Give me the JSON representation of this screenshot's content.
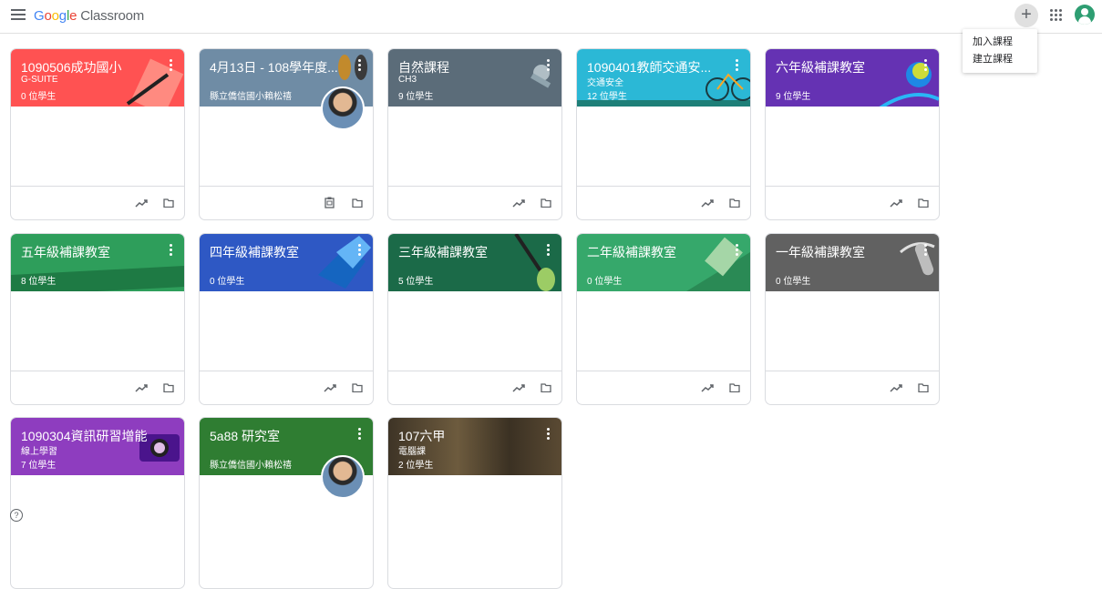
{
  "header": {
    "brand_google": [
      "G",
      "o",
      "o",
      "g",
      "l",
      "e"
    ],
    "app_name": "Classroom",
    "plus_symbol": "+",
    "icons": {
      "menu": "menu-icon",
      "plus": "plus-icon",
      "apps": "apps-grid-icon",
      "account": "account-avatar-icon"
    }
  },
  "dropdown": {
    "items": [
      "加入課程",
      "建立課程"
    ]
  },
  "cards": [
    {
      "title": "1090506成功國小",
      "sub": "G-SUITE",
      "count": "0 位學生",
      "color": "#ff5252"
    },
    {
      "title": "4月13日 - 108學年度...",
      "sub": "縣立僑信國小賴松禧",
      "count": "",
      "color": "#6f8ca5"
    },
    {
      "title": "自然課程",
      "sub": "CH3",
      "count": "9 位學生",
      "color": "#5b6c79"
    },
    {
      "title": "1090401教師交通安...",
      "sub": "交通安全",
      "count": "12 位學生",
      "color": "#2bb8d6"
    },
    {
      "title": "六年級補課教室",
      "sub": "",
      "count": "9 位學生",
      "color": "#6532b3"
    },
    {
      "title": "五年級補課教室",
      "sub": "",
      "count": "8 位學生",
      "color": "#2e9e5b"
    },
    {
      "title": "四年級補課教室",
      "sub": "",
      "count": "0 位學生",
      "color": "#2e58c4"
    },
    {
      "title": "三年級補課教室",
      "sub": "",
      "count": "5 位學生",
      "color": "#1b6a48"
    },
    {
      "title": "二年級補課教室",
      "sub": "",
      "count": "0 位學生",
      "color": "#36a86b"
    },
    {
      "title": "一年級補課教室",
      "sub": "",
      "count": "0 位學生",
      "color": "#616161"
    },
    {
      "title": "1090304資訊研習增能",
      "sub": "線上學習",
      "count": "7 位學生",
      "color": "#8e3dbf"
    },
    {
      "title": "5a88 研究室",
      "sub": "縣立僑信國小賴松禧",
      "count": "",
      "color": "#2f7d32"
    },
    {
      "title": "107六甲",
      "sub": "電腦課",
      "count": "2 位學生",
      "color": "#4a4030"
    }
  ],
  "footer_icons": {
    "trend": "trending-icon",
    "folder": "folder-icon",
    "clip": "clipboard-icon"
  },
  "help": {
    "symbol": "?"
  }
}
